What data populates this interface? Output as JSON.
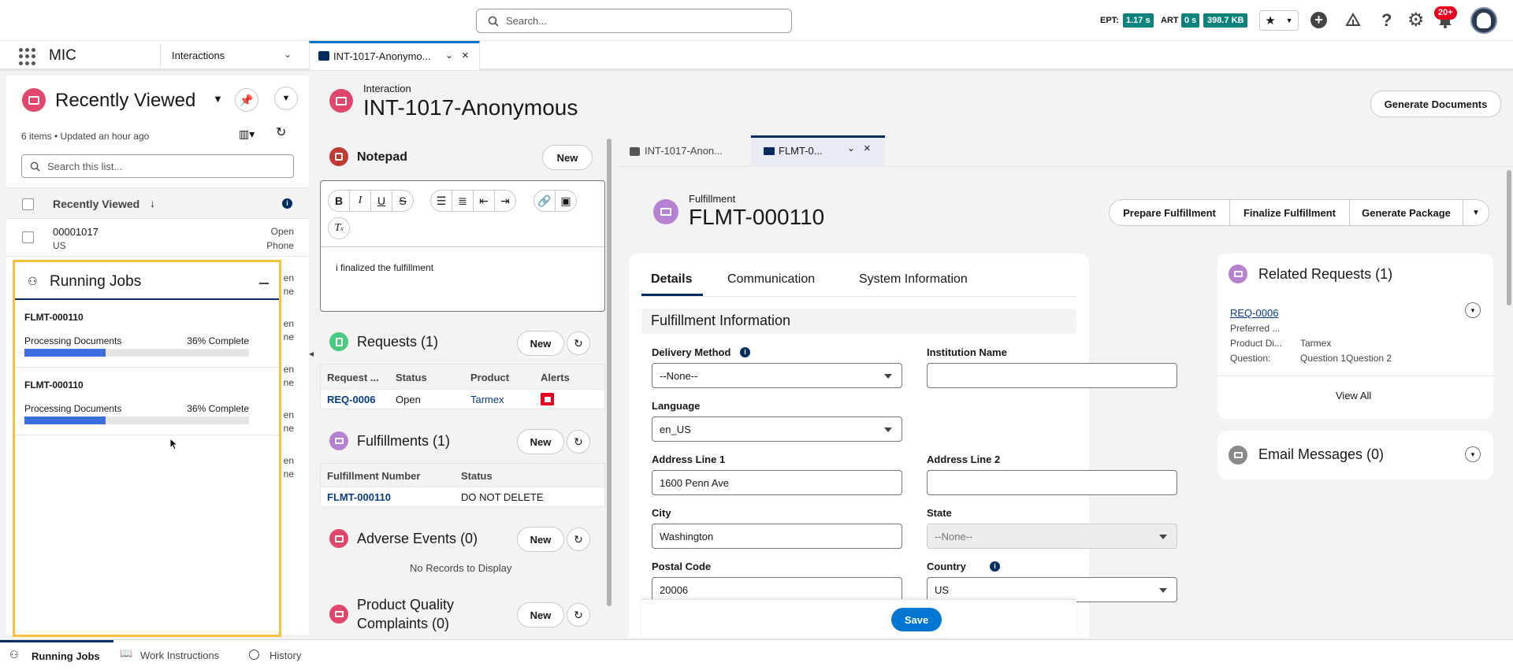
{
  "global_header": {
    "search_placeholder": "Search...",
    "ept_label": "EPT:",
    "ept_value": "1.17 s",
    "art_label": "ART",
    "art_value": "0 s",
    "size_value": "398.7 KB",
    "notifications_badge": "20+"
  },
  "nav": {
    "app_name": "MIC",
    "nav_item": "Interactions",
    "tab_label": "INT-1017-Anonymo..."
  },
  "list_view": {
    "title": "Recently Viewed",
    "meta": "6 items • Updated an hour ago",
    "search_placeholder": "Search this list...",
    "column_header": "Recently Viewed",
    "rows": [
      {
        "name": "00001017",
        "sub": "US",
        "status": "Open",
        "channel": "Phone"
      }
    ],
    "partial_rows": [
      {
        "a": "en",
        "b": "ne"
      },
      {
        "a": "en",
        "b": "ne"
      },
      {
        "a": "en",
        "b": "ne"
      },
      {
        "a": "en",
        "b": "ne"
      },
      {
        "a": "en",
        "b": "ne"
      }
    ]
  },
  "running_jobs": {
    "title": "Running Jobs",
    "jobs": [
      {
        "name": "FLMT-000110",
        "status": "Processing Documents",
        "percent_label": "36% Complete",
        "progress": 0.36
      },
      {
        "name": "FLMT-000110",
        "status": "Processing Documents",
        "percent_label": "36% Complete",
        "progress": 0.36
      }
    ]
  },
  "interaction": {
    "object_label": "Interaction",
    "title": "INT-1017-Anonymous",
    "generate_documents": "Generate Documents"
  },
  "notepad": {
    "title": "Notepad",
    "new_label": "New",
    "content": "i finalized the fulfillment"
  },
  "requests": {
    "title": "Requests (1)",
    "new_label": "New",
    "headers": [
      "Request ...",
      "Status",
      "Product",
      "Alerts"
    ],
    "rows": [
      {
        "id": "REQ-0006",
        "status": "Open",
        "product": "Tarmex"
      }
    ]
  },
  "fulfillments": {
    "title": "Fulfillments (1)",
    "new_label": "New",
    "headers": [
      "Fulfillment Number",
      "Status"
    ],
    "rows": [
      {
        "id": "FLMT-000110",
        "status": "DO NOT DELETE"
      }
    ]
  },
  "adverse_events": {
    "title": "Adverse Events (0)",
    "new_label": "New",
    "empty": "No Records to Display"
  },
  "pqc": {
    "title_line1": "Product Quality",
    "title_line2": "Complaints (0)",
    "new_label": "New"
  },
  "subtabs": [
    {
      "label": "INT-1017-Anon..."
    },
    {
      "label": "FLMT-0..."
    }
  ],
  "fulfillment": {
    "object_label": "Fulfillment",
    "title": "FLMT-000110",
    "actions": [
      "Prepare Fulfillment",
      "Finalize Fulfillment",
      "Generate Package"
    ],
    "tabs": [
      "Details",
      "Communication",
      "System Information"
    ],
    "section_title": "Fulfillment Information",
    "fields": {
      "delivery_method_label": "Delivery Method",
      "delivery_method_value": "--None--",
      "institution_label": "Institution Name",
      "institution_value": "",
      "language_label": "Language",
      "language_value": "en_US",
      "address1_label": "Address Line 1",
      "address1_value": "1600 Penn Ave",
      "address2_label": "Address Line 2",
      "address2_value": "",
      "city_label": "City",
      "city_value": "Washington",
      "state_label": "State",
      "state_value": "--None--",
      "postal_label": "Postal Code",
      "postal_value": "20006",
      "country_label": "Country",
      "country_value": "US"
    },
    "save_label": "Save"
  },
  "related_requests": {
    "title": "Related Requests (1)",
    "id": "REQ-0006",
    "lines": [
      {
        "label": "Preferred ...",
        "value": ""
      },
      {
        "label": "Product Di...",
        "value": "Tarmex"
      },
      {
        "label": "Question:",
        "value": "Question 1Question 2"
      }
    ],
    "view_all": "View All"
  },
  "email_messages": {
    "title": "Email Messages (0)"
  },
  "utility_bar": {
    "items": [
      "Running Jobs",
      "Work Instructions",
      "History"
    ]
  },
  "colors": {
    "accent": "#0176d3",
    "brand_pink": "#e3466c",
    "purple": "#b781d3",
    "progress": "#3b6fe0",
    "highlight": "#f5c33b",
    "badge_teal": "#0b827c"
  }
}
